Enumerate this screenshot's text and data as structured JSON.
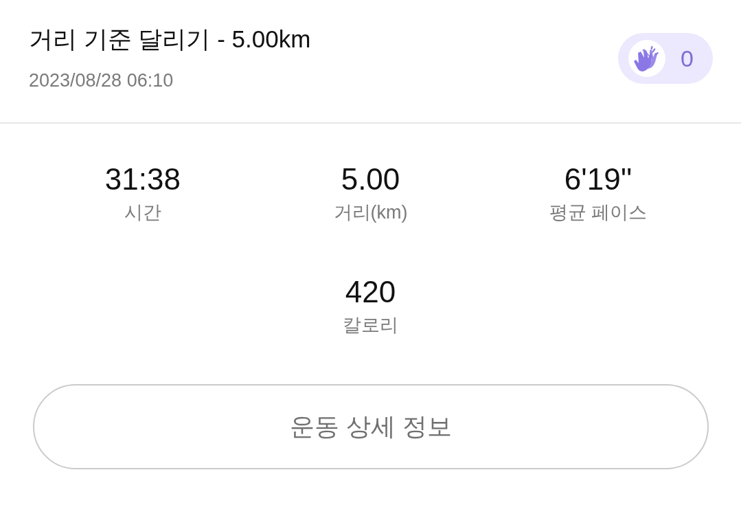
{
  "header": {
    "title": "거리 기준 달리기 - 5.00km",
    "datetime": "2023/08/28 06:10",
    "claps": {
      "count": "0"
    }
  },
  "stats": [
    {
      "value": "31:38",
      "label": "시간"
    },
    {
      "value": "5.00",
      "label": "거리(km)"
    },
    {
      "value": "6'19''",
      "label": "평균 페이스"
    },
    {
      "value": "420",
      "label": "칼로리"
    }
  ],
  "detail_button": {
    "label": "운동 상세 정보"
  }
}
